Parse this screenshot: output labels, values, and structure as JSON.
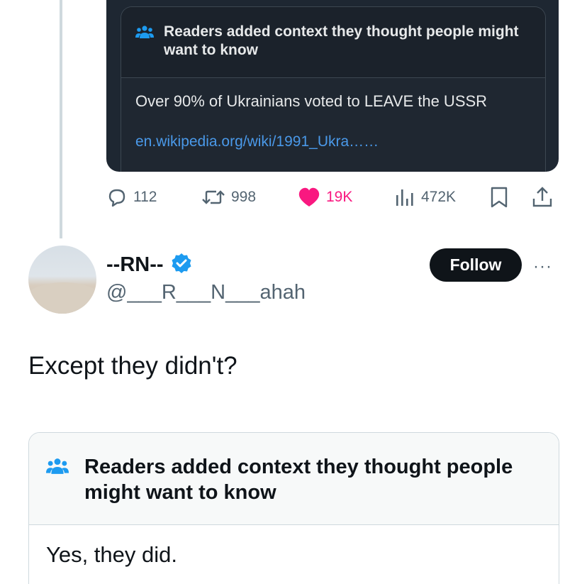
{
  "quoted_post": {
    "note": {
      "title": "Readers added context they thought people might want to know",
      "body": "Over 90% of Ukrainians voted to LEAVE the USSR",
      "link": "en.wikipedia.org/wiki/1991_Ukra……"
    },
    "actions": {
      "replies": "112",
      "reposts": "998",
      "likes": "19K",
      "views": "472K"
    }
  },
  "post": {
    "display_name": "--RN--",
    "handle": "@___R___N___ahah",
    "follow_label": "Follow",
    "more_label": "···",
    "text": "Except they didn't?",
    "note": {
      "title": "Readers added context they thought people might want to know",
      "body": "Yes, they did."
    }
  },
  "colors": {
    "like": "#f91880",
    "link": "#4a99e9",
    "verified": "#1d9bf0",
    "note_icon": "#1d9bf0"
  }
}
